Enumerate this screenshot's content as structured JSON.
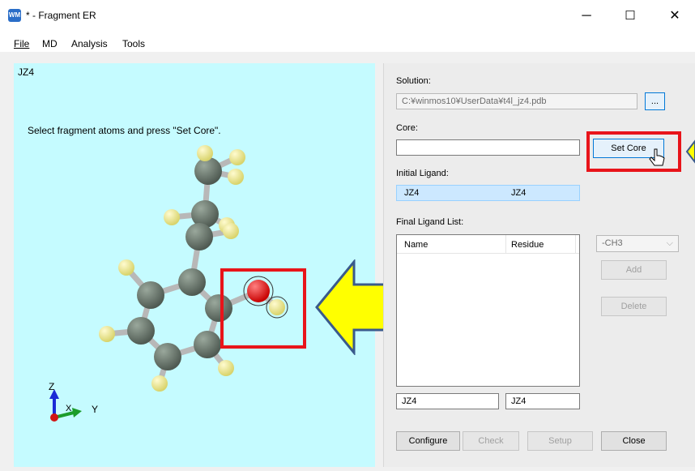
{
  "window": {
    "title": "* - Fragment ER",
    "icon": "app-icon",
    "icon_text": "WM",
    "minimize": "─",
    "maximize": "☐",
    "close": "✕"
  },
  "menu": {
    "file": "File",
    "md": "MD",
    "analysis": "Analysis",
    "tools": "Tools"
  },
  "viewer": {
    "molecule_label": "JZ4",
    "hint": "Select fragment atoms and press \"Set Core\".",
    "axes": {
      "z": "Z",
      "x": "X",
      "y": "Y"
    }
  },
  "panel": {
    "solution_label": "Solution:",
    "solution_value": "C:¥winmos10¥UserData¥t4l_jz4.pdb",
    "browse_label": "...",
    "core_label": "Core:",
    "core_value": "",
    "set_core_label": "Set Core",
    "initial_ligand_label": "Initial Ligand:",
    "initial_ligand": {
      "name": "JZ4",
      "residue": "JZ4"
    },
    "final_list_label": "Final Ligand List:",
    "list_headers": {
      "name": "Name",
      "residue": "Residue"
    },
    "dropdown_value": "-CH3",
    "add_label": "Add",
    "delete_label": "Delete",
    "name_field": "JZ4",
    "residue_field": "JZ4",
    "configure_label": "Configure",
    "check_label": "Check",
    "setup_label": "Setup",
    "close_label": "Close"
  },
  "colors": {
    "viewer_bg": "#c5fbff",
    "highlight": "#e8141a",
    "arrow_fill": "#ffff00",
    "arrow_stroke": "#3a5a8c",
    "carbon": "#5f6b62",
    "hydrogen": "#f4f08a",
    "oxygen": "#e10000"
  }
}
